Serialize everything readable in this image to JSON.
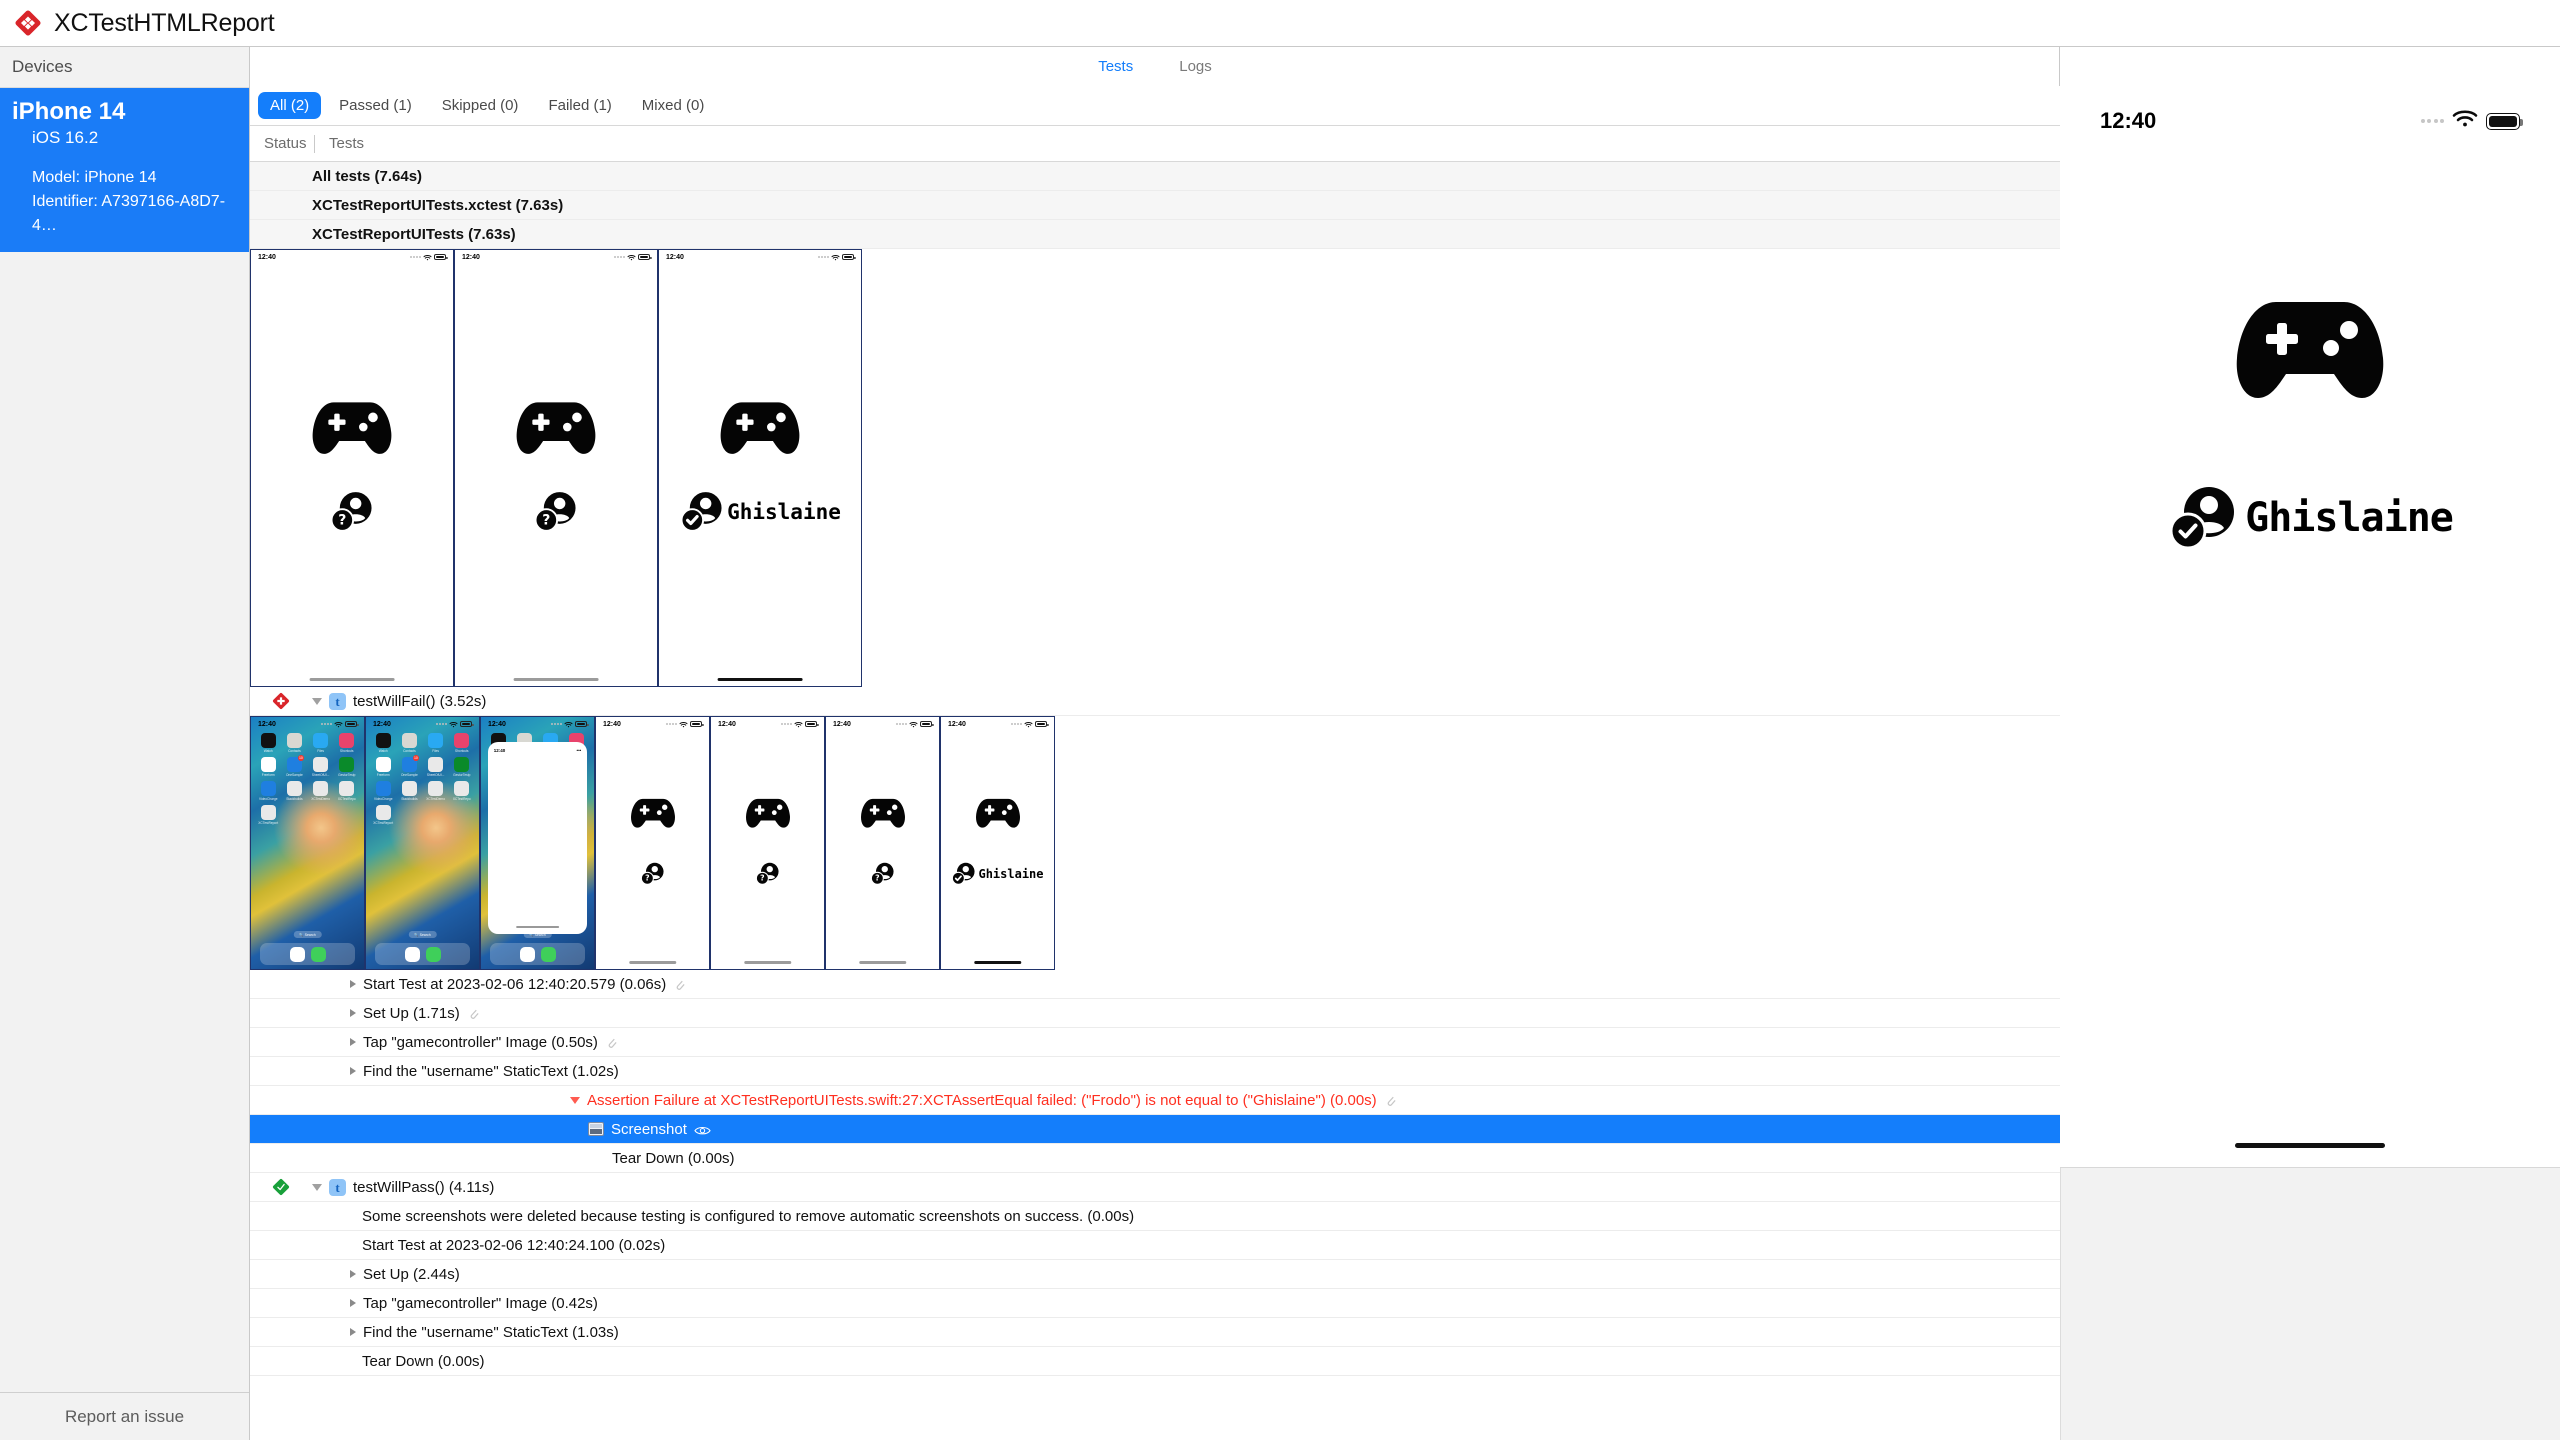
{
  "app": {
    "title": "XCTestHTMLReport",
    "logo_icon": "red-diamond-logo",
    "accent_color": "#147efb",
    "fail_color": "#ff2f20",
    "pass_color": "#18a03a"
  },
  "top_tabs": [
    {
      "label": "Tests",
      "active": true
    },
    {
      "label": "Logs",
      "active": false
    }
  ],
  "sidebar": {
    "header": "Devices",
    "device": {
      "name": "iPhone 14",
      "os": "iOS 16.2",
      "model": "Model: iPhone 14",
      "identifier": "Identifier: A7397166-A8D7-4…"
    },
    "footer_link": "Report an issue"
  },
  "filters": [
    {
      "label": "All (2)",
      "active": true
    },
    {
      "label": "Passed (1)",
      "active": false
    },
    {
      "label": "Skipped (0)",
      "active": false
    },
    {
      "label": "Failed (1)",
      "active": false
    },
    {
      "label": "Mixed (0)",
      "active": false
    }
  ],
  "columns": {
    "status": "Status",
    "tests": "Tests"
  },
  "tree": {
    "all_tests": "All tests (7.64s)",
    "bundle": "XCTestReportUITests.xctest (7.63s)",
    "suite": "XCTestReportUITests (7.63s)",
    "fail_test": "testWillFail() (3.52s)",
    "pass_test": "testWillPass() (4.11s)",
    "fail_activities": [
      "Start Test at 2023-02-06 12:40:20.579 (0.06s)",
      "Set Up (1.71s)",
      "Tap \"gamecontroller\" Image (0.50s)",
      "Find the \"username\" StaticText (1.02s)"
    ],
    "assertion": "Assertion Failure at XCTestReportUITests.swift:27:XCTAssertEqual failed: (\"Frodo\") is not equal to (\"Ghislaine\") (0.00s)",
    "screenshot_label": "Screenshot",
    "fail_teardown": "Tear Down (0.00s)",
    "pass_note": "Some screenshots were deleted because testing is configured to remove automatic screenshots on success. (0.00s)",
    "pass_activities": [
      "Start Test at 2023-02-06 12:40:24.100 (0.02s)",
      "Set Up (2.44s)",
      "Tap \"gamecontroller\" Image (0.42s)",
      "Find the \"username\" StaticText (1.03s)",
      "Tear Down (0.00s)"
    ]
  },
  "screen_time": "12:40",
  "username": "Ghislaine",
  "strip_top": [
    {
      "kind": "app",
      "person": "question",
      "name": ""
    },
    {
      "kind": "app",
      "person": "question",
      "name": ""
    },
    {
      "kind": "app",
      "person": "check",
      "name": "Ghislaine"
    }
  ],
  "strip_bottom": [
    {
      "kind": "home",
      "person": "",
      "name": ""
    },
    {
      "kind": "home",
      "person": "",
      "name": ""
    },
    {
      "kind": "launch",
      "person": "",
      "name": ""
    },
    {
      "kind": "app",
      "person": "question",
      "name": ""
    },
    {
      "kind": "app",
      "person": "question",
      "name": ""
    },
    {
      "kind": "app",
      "person": "question",
      "name": ""
    },
    {
      "kind": "app",
      "person": "check",
      "name": "Ghislaine"
    }
  ],
  "ios_apps": [
    {
      "label": "Watch",
      "color": "#111111"
    },
    {
      "label": "Contacts",
      "color": "#d8d8d2"
    },
    {
      "label": "Files",
      "color": "#29a9f2"
    },
    {
      "label": "Shortcuts",
      "color": "#e8436c"
    },
    {
      "label": "Freeform",
      "color": "#ffffff"
    },
    {
      "label": "OneSample",
      "color": "#1f7fe0"
    },
    {
      "label": "SheetOfUI...",
      "color": "#e9e9e9"
    },
    {
      "label": "GesturTestp",
      "color": "#0a8a2a"
    },
    {
      "label": "VideoCharge",
      "color": "#1f7fe0"
    },
    {
      "label": "Stackbuilds",
      "color": "#e9e9e9"
    },
    {
      "label": "XCTestDemo",
      "color": "#e9e9e9"
    },
    {
      "label": "XCTestRepo",
      "color": "#e9e9e9"
    },
    {
      "label": "XCTestReport",
      "color": "#e9e9e9"
    }
  ],
  "ios_search": "Search",
  "preview": {
    "time": "12:40",
    "name": "Ghislaine"
  },
  "icons": {
    "gamepad": "gamecontroller-icon",
    "person_question": "person-badge-question-icon",
    "person_check": "person-badge-check-icon",
    "wifi": "wifi-icon",
    "battery": "battery-icon",
    "attachment": "paperclip-icon",
    "eye": "eye-icon",
    "screenshot": "screenshot-icon"
  }
}
